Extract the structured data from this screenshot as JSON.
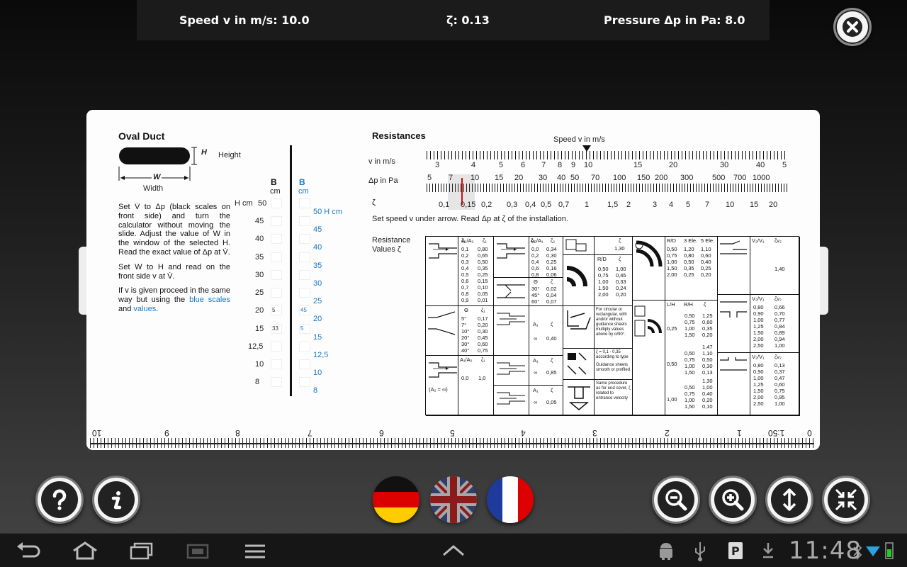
{
  "topbar": {
    "speed": "Speed v in m/s: 10.0",
    "zeta": "ζ: 0.13",
    "pressure": "Pressure Δp in Pa: 8.0"
  },
  "oval": {
    "title": "Oval Duct",
    "height": "Height",
    "width": "Width",
    "h_letter": "H",
    "w_letter": "W",
    "para1": "Set V̇ to Δp (black scales on front side) and turn the calculator without moving the slide. Adjust the value of W in the window of the selected H. Read the exact value of Δp at V̇.",
    "para2": "Set W to H and read on the front side v at V̇.",
    "para3_a": "If v is given proceed in the same way but using the",
    "para3_blue1": "blue scales",
    "para3_and": "and",
    "para3_blue2": "values",
    "para3_end": ".",
    "b_black": "B",
    "cm_black": "cm",
    "b_blue": "B",
    "cm_blue": "cm",
    "h_label": "H cm",
    "h_values": [
      "50",
      "45",
      "40",
      "35",
      "30",
      "25",
      "20",
      "15",
      "12,5",
      "10",
      "8"
    ],
    "blue_values": [
      "50 H cm",
      "45",
      "40",
      "35",
      "30",
      "25",
      "20",
      "15",
      "12,5",
      "10",
      "8"
    ],
    "slot_marks": [
      "",
      "",
      "",
      "",
      "",
      "",
      "5",
      "33",
      "",
      "",
      ""
    ],
    "blue_slot_marks": [
      "",
      "",
      "",
      "",
      "",
      "",
      "45",
      "5",
      "",
      "",
      ""
    ]
  },
  "resist": {
    "title": "Resistances",
    "speed_label": "Speed v in m/s",
    "v_label": "v in m/s",
    "dp_label": "Δp in Pa",
    "zeta_label": "ζ",
    "v_ticks": [
      "3",
      "4",
      "5",
      "6",
      "7",
      "8",
      "9",
      "10",
      "15",
      "20",
      "30",
      "40",
      "5"
    ],
    "dp_ticks": [
      "5",
      "7",
      "10",
      "15",
      "20",
      "30",
      "40",
      "50",
      "70",
      "100",
      "150",
      "200",
      "300",
      "500",
      "700",
      "1000"
    ],
    "zeta_ticks": [
      "0,1",
      "0,15",
      "0,2",
      "0,3",
      "0,4",
      "0,5",
      "0,7",
      "1",
      "1,5",
      "2",
      "3",
      "4",
      "5",
      "7",
      "10",
      "15",
      "20"
    ],
    "instruction": "Set speed v under arrow. Read Δp at ζ of the installation.",
    "values_label_1": "Resistance",
    "values_label_2": "Values ζ"
  },
  "table": {
    "c1_head": [
      "A₁/A₂",
      "ζ₁"
    ],
    "c1_ratios": [
      "0,1",
      "0,2",
      "0,3",
      "0,4",
      "0,5",
      "0,6",
      "0,7",
      "0,8",
      "0,9"
    ],
    "c1_zeta": [
      "0,80",
      "0,65",
      "0,50",
      "0,35",
      "0,25",
      "0,15",
      "0,10",
      "0,05",
      "0,01"
    ],
    "c2_head": [
      "A₂/A₁",
      "ζ₂"
    ],
    "c2_ratios": [
      "0,0",
      "0,2",
      "0,4",
      "0,6",
      "0,8"
    ],
    "c2_zeta": [
      "0,34",
      "0,30",
      "0,25",
      "0,16",
      "0,06"
    ],
    "theta_head": [
      "Θ",
      "ζ"
    ],
    "theta_vals": [
      "30°",
      "45°",
      "60°"
    ],
    "theta_zeta": [
      "0,02",
      "0,04",
      "0,07"
    ],
    "c1b_head": [
      "Θ",
      "ζ₁"
    ],
    "c1b_angles": [
      "5°",
      "7°",
      "10°",
      "20°",
      "30°",
      "40°"
    ],
    "c1b_zeta": [
      "0,17",
      "0,20",
      "0,30",
      "0,45",
      "0,60",
      "0,75"
    ],
    "c1c_head": [
      "A₁/A₂",
      "ζ₁"
    ],
    "c1c_vals": [
      "0,0",
      "1,0"
    ],
    "a2_inf": "(A₂ = ∞)",
    "a1_rows": [
      [
        "A₁",
        "ζ"
      ],
      [
        "∞",
        "0,40"
      ],
      [
        "A₁",
        "ζ"
      ],
      [
        "∞",
        "0,85"
      ],
      [
        "A₁",
        "ζ"
      ],
      [
        "∞",
        "0,05"
      ]
    ],
    "bend_head": "ζ",
    "bend_val": "1,30",
    "rd_head": [
      "R/D",
      "ζ"
    ],
    "rd_vals": [
      "0,50",
      "0,75",
      "1,00",
      "1,50",
      "2,00"
    ],
    "rd_zeta": [
      "1,00",
      "0,45",
      "0,33",
      "0,24",
      "0,20"
    ],
    "note1": "For circular or rectangular, with and/or without guidance sheets multiply values above by α/90°.",
    "note2a": "ζ = 0,1 - 0,35 according to type",
    "note2b": "Guidance sheets smooth or profiled",
    "note3": "Same procedure as for end cover, ζ related to entrance velocity",
    "ele_head": [
      "R/D",
      "3 Ele.",
      "5 Ele."
    ],
    "ele_rd": [
      "0,50",
      "0,75",
      "1,00",
      "1,50",
      "2,00"
    ],
    "ele_3": [
      "1,20",
      "0,80",
      "0,50",
      "0,35",
      "0,25"
    ],
    "ele_5": [
      "1,10",
      "0,60",
      "0,40",
      "0,25",
      "0,20"
    ],
    "lh_head": [
      "L/H",
      "R/H",
      "ζ"
    ],
    "lh_1": [
      "0,25",
      "0,50",
      "1,00"
    ],
    "rh_vals": [
      "0,50",
      "0,75",
      "1,00",
      "1,50"
    ],
    "lh_z1": [
      "1,25",
      "0,60",
      "0,35",
      "0,20"
    ],
    "lh_z2": [
      "1,47",
      "1,10",
      "0,50",
      "0,30",
      "0,13"
    ],
    "lh_z3": [
      "1,30",
      "1,00",
      "0,40",
      "0,20",
      "0,10"
    ],
    "v2_head": [
      "V₂/V₁",
      "ζv₂"
    ],
    "v2_a": "1,40",
    "v2_b_r": [
      "0,80",
      "0,90",
      "1,00",
      "1,25",
      "1,50",
      "2,00",
      "2,50"
    ],
    "v2_b_z": [
      "0,66",
      "0,70",
      "0,77",
      "0,84",
      "0,89",
      "0,94",
      "1,00"
    ],
    "v2_c_r": [
      "0,80",
      "0,90",
      "1,00",
      "1,25",
      "1,50",
      "2,00",
      "2,50"
    ],
    "v2_c_z": [
      "0,13",
      "0,37",
      "0,47",
      "0,60",
      "0,75",
      "0,95",
      "1,00"
    ]
  },
  "ruler": {
    "labels": [
      "10",
      "9",
      "8",
      "7",
      "6",
      "5",
      "4",
      "3",
      "2",
      "1",
      "1:50",
      "0"
    ]
  },
  "buttons": {
    "help": "help-icon",
    "info": "info-icon",
    "zoom_out": "zoom-out-icon",
    "zoom_in": "zoom-in-icon",
    "flip": "flip-vertical-icon",
    "fit": "fit-screen-icon"
  },
  "flags": [
    "German",
    "British",
    "French"
  ],
  "statusbar": {
    "clock": "11:48"
  },
  "colors": {
    "blue_scale": "#1a79c4",
    "red_marker": "#d01010",
    "card": "#fdfdfd"
  }
}
